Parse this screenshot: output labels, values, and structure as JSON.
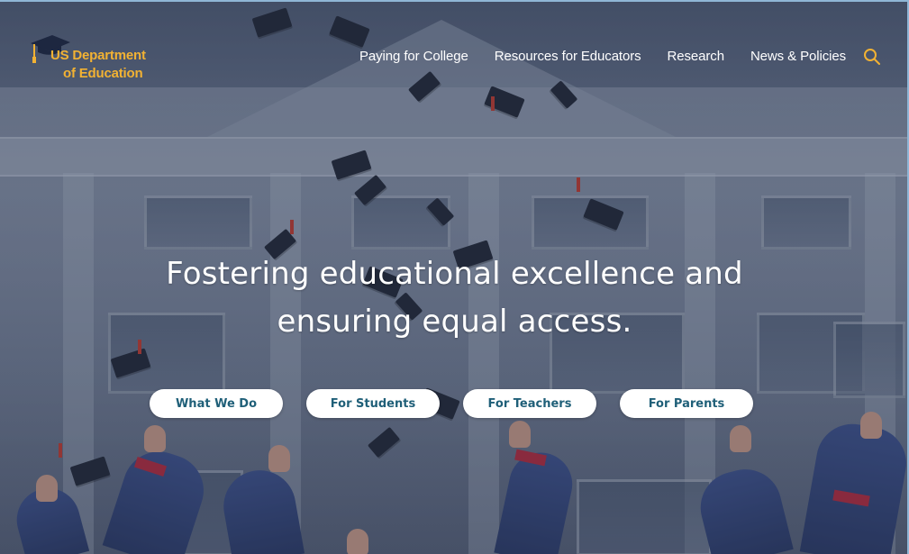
{
  "header": {
    "logo": {
      "line1": "US Department",
      "line2": "of Education",
      "color": "#f2b233",
      "icon": "graduation-cap-icon"
    },
    "nav": [
      {
        "label": "Paying for College"
      },
      {
        "label": "Resources for Educators"
      },
      {
        "label": "Research"
      },
      {
        "label": "News & Policies"
      }
    ],
    "search_icon": "search-icon",
    "search_color": "#f2b233"
  },
  "hero": {
    "title_line1": "Fostering educational excellence and",
    "title_line2": "ensuring equal access.",
    "background_image": "graduation caps thrown in front of a university building",
    "buttons": [
      {
        "label": "What We Do"
      },
      {
        "label": "For Students"
      },
      {
        "label": "For Teachers"
      },
      {
        "label": "For Parents"
      }
    ],
    "button_text_color": "#1f5f78"
  }
}
